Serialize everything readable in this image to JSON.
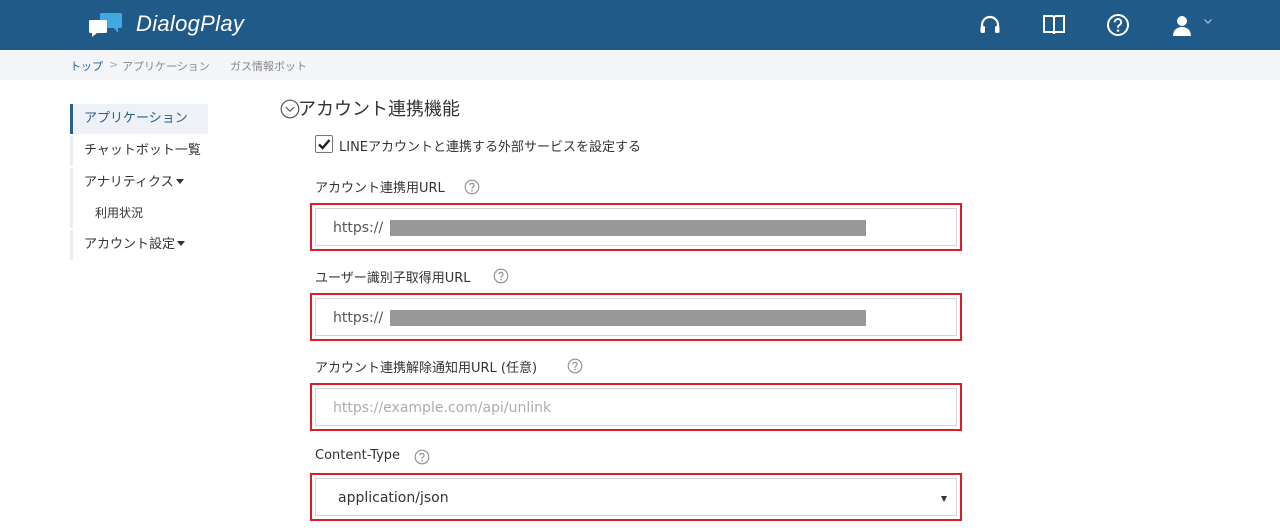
{
  "app": {
    "name": "DialogPlay"
  },
  "breadcrumb": {
    "items": [
      "トップ",
      "アプリケーション",
      "ガス情報ボット"
    ],
    "separator": ">"
  },
  "sidebar": {
    "items": [
      {
        "label": "アプリケーション",
        "active": true
      },
      {
        "label": "チャットボット一覧"
      },
      {
        "label": "アナリティクス",
        "has_dropdown": true
      },
      {
        "label": "利用状況",
        "sub": true
      },
      {
        "label": "アカウント設定",
        "has_dropdown": true
      }
    ]
  },
  "section": {
    "title": "アカウント連携機能",
    "checkbox_label": "LINEアカウントと連携する外部サービスを設定する",
    "checkbox_checked": true,
    "fields": [
      {
        "label": "アカウント連携用URL",
        "value": "https://"
      },
      {
        "label": "ユーザー識別子取得用URL",
        "value": "https://"
      },
      {
        "label": "アカウント連携解除通知用URL (任意)",
        "placeholder": "https://example.com/api/unlink"
      },
      {
        "label": "Content-Type",
        "value": "application/json"
      }
    ]
  },
  "colors": {
    "header": "#1f5a88",
    "highlight": "#dc1e2a",
    "accent": "#2a5f8f",
    "logo_accent": "#3fa9e0"
  },
  "icons": {
    "header": [
      "headset-icon",
      "book-icon",
      "help-icon",
      "user-icon"
    ]
  }
}
